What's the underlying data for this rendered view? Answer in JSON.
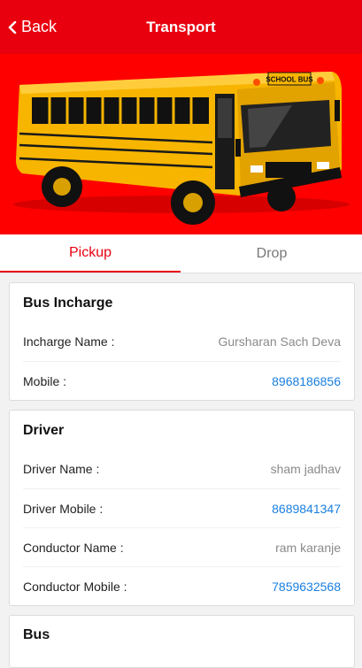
{
  "header": {
    "back_label": "Back",
    "title": "Transport"
  },
  "banner": {
    "bus_sign": "SCHOOL BUS",
    "colors": {
      "background": "#ff0000",
      "bus": "#f7b500"
    }
  },
  "tabs": [
    {
      "label": "Pickup",
      "active": true
    },
    {
      "label": "Drop",
      "active": false
    }
  ],
  "bus_incharge": {
    "title": "Bus Incharge",
    "rows": [
      {
        "label": "Incharge Name :",
        "value": "Gursharan Sach Deva"
      },
      {
        "label": "Mobile :",
        "value": "8968186856"
      }
    ]
  },
  "driver": {
    "title": "Driver",
    "rows": [
      {
        "label": "Driver Name :",
        "value": "sham jadhav"
      },
      {
        "label": "Driver Mobile :",
        "value": "8689841347"
      },
      {
        "label": "Conductor Name :",
        "value": "ram karanje"
      },
      {
        "label": "Conductor Mobile :",
        "value": "7859632568"
      }
    ]
  },
  "bus": {
    "title": "Bus"
  },
  "colors": {
    "accent": "#e8000f",
    "link": "#1a7fe0"
  }
}
